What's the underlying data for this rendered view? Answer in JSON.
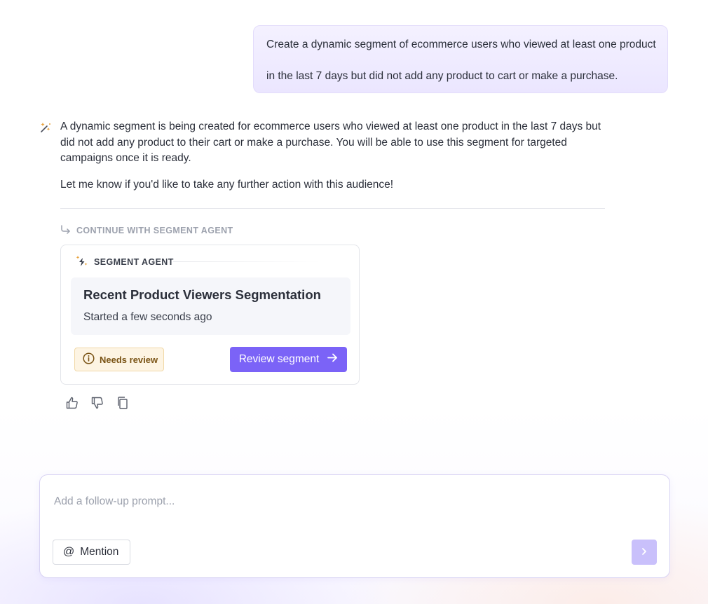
{
  "user_message": {
    "line1": "Create a dynamic segment of ecommerce users who viewed at least one product",
    "line2": "in the last 7 days but did not add any product to cart or make a purchase."
  },
  "assistant": {
    "paragraph1": "A dynamic segment is being created for ecommerce users who viewed at least one product in the last 7 days but did not add any product to their cart or make a purchase. You will be able to use this segment for targeted campaigns once it is ready.",
    "paragraph2": "Let me know if you'd like to take any further action with this audience!"
  },
  "continue_label": "CONTINUE WITH SEGMENT AGENT",
  "agent_card": {
    "header": "SEGMENT AGENT",
    "title": "Recent Product Viewers Segmentation",
    "subtitle": "Started a few seconds ago",
    "status": "Needs review",
    "action_label": "Review segment"
  },
  "composer": {
    "placeholder": "Add a follow-up prompt...",
    "mention_label": "Mention"
  },
  "colors": {
    "accent": "#7b63f7",
    "accent_disabled": "#c9c0fb",
    "warning_bg": "#fdf4e3",
    "warning_text": "#7a5416"
  }
}
